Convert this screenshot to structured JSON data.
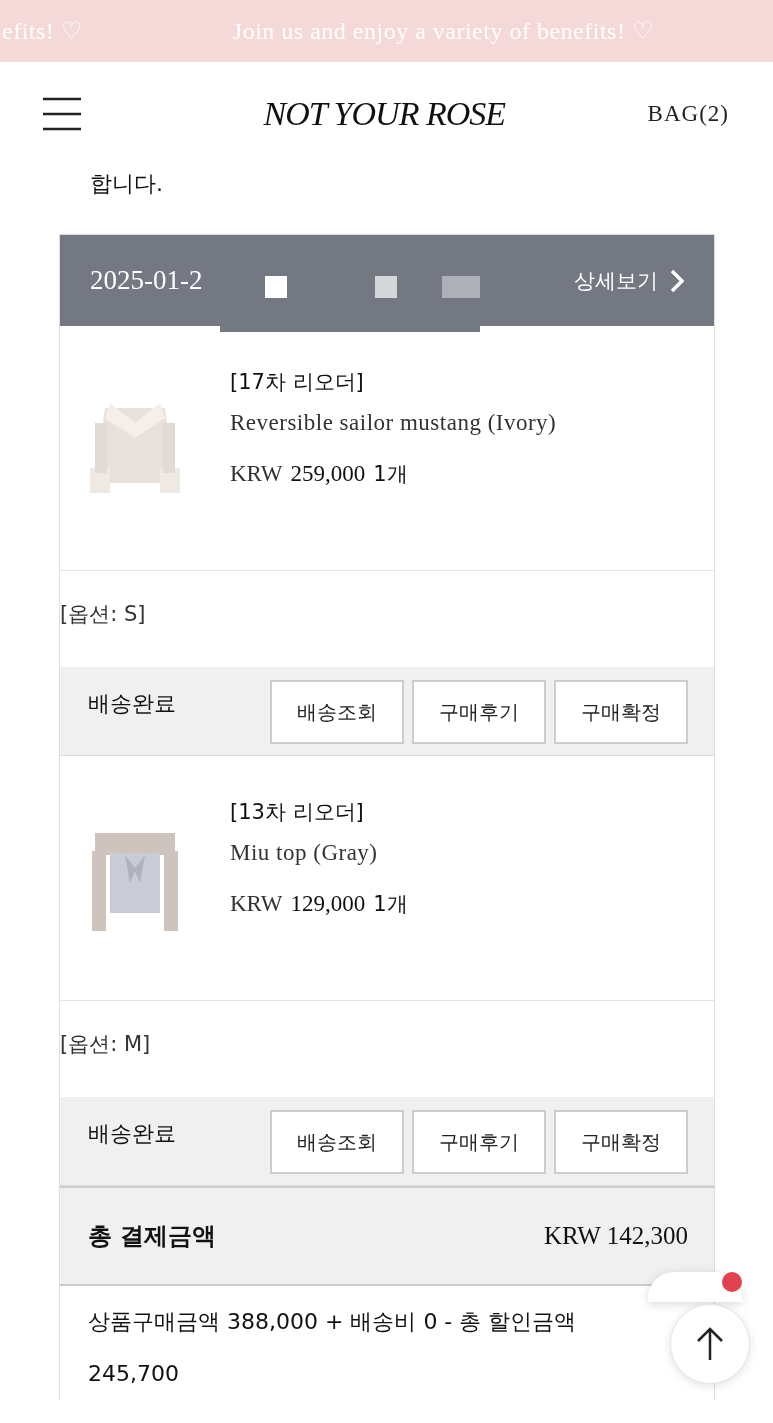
{
  "banner": {
    "messages": [
      "efits! ♡",
      "Join us and enjoy a variety of benefits! ♡"
    ]
  },
  "header": {
    "logo": "NOT YOUR ROSE",
    "bag": "BAG(2)"
  },
  "notice": "합니다.",
  "order": {
    "date": "2025-01-2",
    "detail_link": "상세보기",
    "items": [
      {
        "batch": "[17차 리오더]",
        "name": "Reversible sailor mustang (Ivory)",
        "currency": "KRW",
        "price": "259,000",
        "quantity": "1개",
        "option": "[옵션: S]",
        "status": "배송완료",
        "actions": [
          "배송조회",
          "구매후기",
          "구매확정"
        ]
      },
      {
        "batch": "[13차 리오더]",
        "name": "Miu top (Gray)",
        "currency": "KRW",
        "price": "129,000",
        "quantity": "1개",
        "option": "[옵션: M]",
        "status": "배송완료",
        "actions": [
          "배송조회",
          "구매후기",
          "구매확정"
        ]
      }
    ],
    "total_label": "총 결제금액",
    "total_value": "KRW 142,300",
    "breakdown": "상품구매금액 388,000 + 배송비 0 - 총 할인금액 245,700"
  },
  "chat": {
    "unread": true
  }
}
